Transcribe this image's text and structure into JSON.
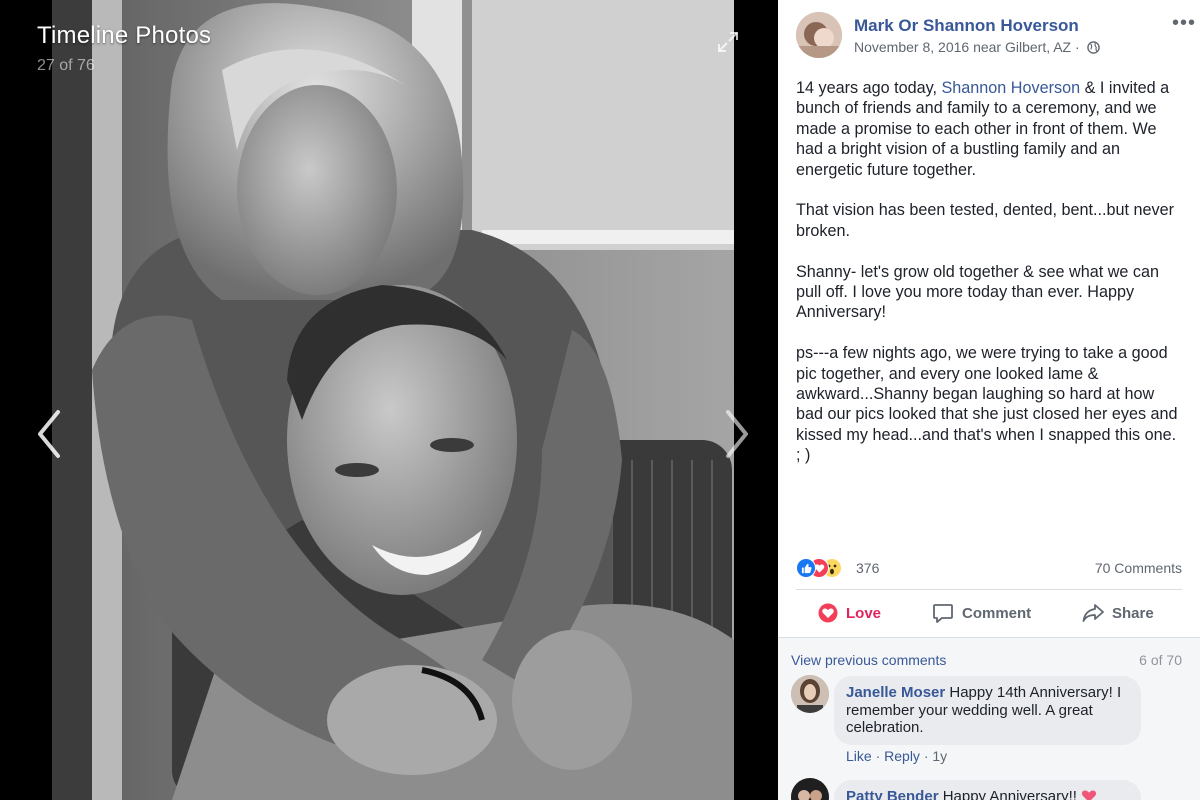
{
  "viewer": {
    "title": "Timeline Photos",
    "counter": "27 of 76",
    "icons": {
      "expand": "expand-icon",
      "prev": "chevron-left-icon",
      "next": "chevron-right-icon"
    }
  },
  "post": {
    "author": "Mark Or Shannon Hoverson",
    "date": "November 8, 2016 near Gilbert, AZ",
    "separator": " · ",
    "more_label": "•••",
    "text": {
      "p1_before": "14 years ago today, ",
      "p1_mention": "Shannon Hoverson",
      "p1_after": " & I invited a bunch of friends and family to a ceremony, and we made a promise to each other in front of them. We had a bright vision of a bustling family and an energetic future together.",
      "p2": "That vision has been tested, dented, bent...but never broken.",
      "p3": "Shanny- let's grow old together & see what we can pull off. I love you more today than ever. Happy Anniversary!",
      "p4": "ps---a few nights ago, we were trying to take a good pic together, and every one looked lame & awkward...Shanny began laughing so hard at how bad our pics looked that she just closed her eyes and kissed my head...and that's when I snapped this one. ; )"
    }
  },
  "reactions": {
    "count": "376",
    "comments_label": "70 Comments",
    "icons": [
      "like-reaction-icon",
      "love-reaction-icon",
      "wow-reaction-icon"
    ]
  },
  "actions": {
    "love": "Love",
    "comment": "Comment",
    "share": "Share"
  },
  "comments": {
    "view_previous": "View previous comments",
    "page_count": "6 of 70",
    "items": [
      {
        "name": "Janelle Moser",
        "text": " Happy 14th Anniversary! I remember your wedding well. A great celebration.",
        "like": "Like",
        "reply": "Reply",
        "time": "1y"
      },
      {
        "name": "Patty Bender",
        "text": " Happy Anniversary!!"
      }
    ]
  },
  "colors": {
    "link": "#385898",
    "love": "#e0245e",
    "muted": "#606770",
    "bubble": "#e9ebee"
  }
}
